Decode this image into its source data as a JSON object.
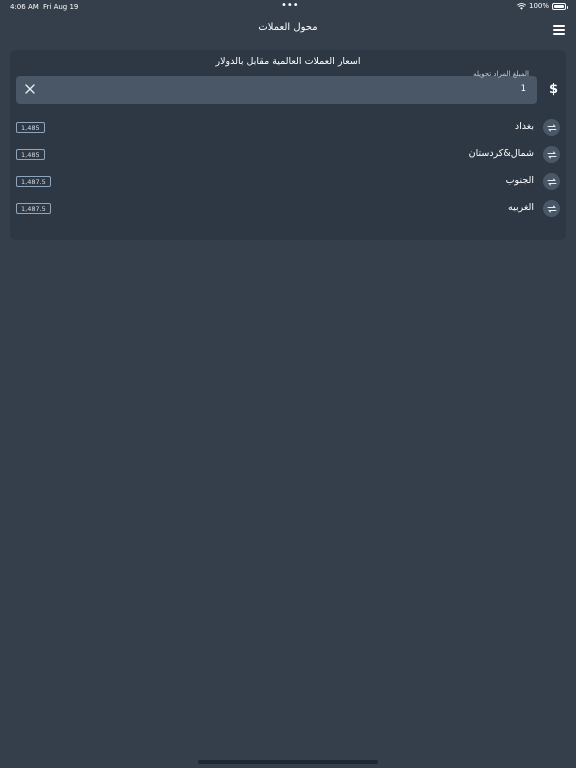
{
  "status_bar": {
    "time": "4:06 AM",
    "date": "Fri Aug 19",
    "dots": "•••",
    "battery": "100%"
  },
  "nav": {
    "title": "محول العملات",
    "menu_icon": "hamburger-menu-icon"
  },
  "converter": {
    "heading": "اسعار العملات العالمية مقابل بالدولار",
    "amount_label": "المبلغ المراد تحويله",
    "amount_value": "1",
    "currency_symbol": "$",
    "clear_icon": "close-icon"
  },
  "rates": [
    {
      "region": "بغداد",
      "value": "1,485"
    },
    {
      "region": "شمال&كردستان",
      "value": "1,485"
    },
    {
      "region": "الجنوب",
      "value": "1,487.5"
    },
    {
      "region": "الغربيه",
      "value": "1,487.5"
    }
  ],
  "colors": {
    "background": "#343f4b",
    "card": "#2e3844",
    "field": "#4a5766",
    "badge_border": "#8fa5bb"
  }
}
